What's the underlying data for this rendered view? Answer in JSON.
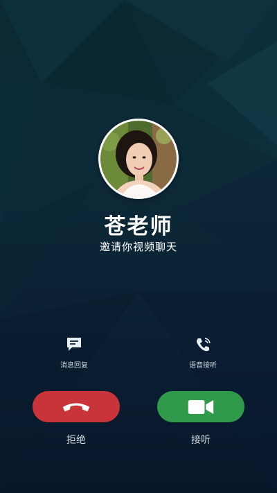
{
  "caller": {
    "name": "苍老师",
    "subtitle": "邀请你视频聊天"
  },
  "quick_actions": {
    "message_reply": "消息回复",
    "voice_answer": "语音接听"
  },
  "buttons": {
    "decline_label": "拒绝",
    "accept_label": "接听"
  },
  "colors": {
    "decline": "#c8343a",
    "accept": "#2f9a4a",
    "background": "#0b2a33"
  },
  "icons": {
    "message": "message-icon",
    "voice": "voice-call-icon",
    "hangup": "phone-hangup-icon",
    "video": "video-camera-icon"
  }
}
